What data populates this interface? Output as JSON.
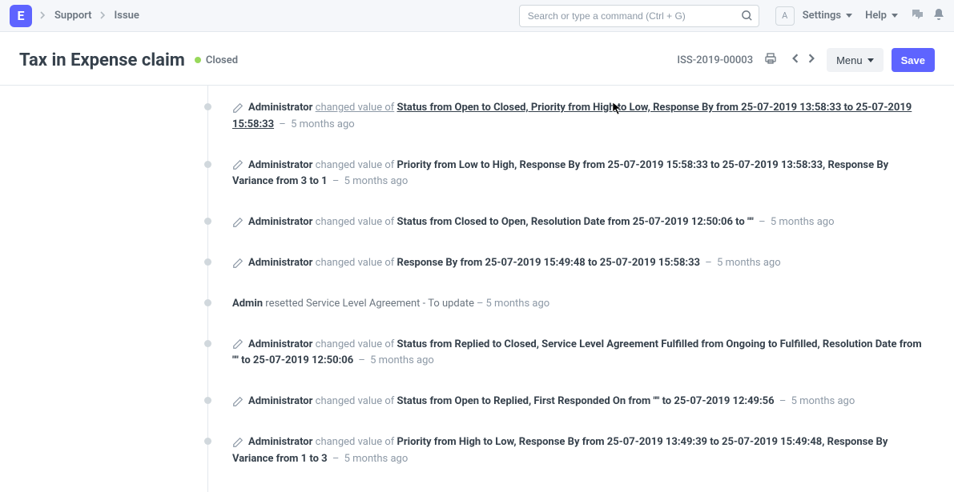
{
  "brand": "E",
  "breadcrumb": {
    "support": "Support",
    "issue": "Issue"
  },
  "search": {
    "placeholder": "Search or type a command (Ctrl + G)"
  },
  "user_initial": "A",
  "nav": {
    "settings": "Settings",
    "help": "Help"
  },
  "page": {
    "title": "Tax in Expense claim",
    "status": "Closed",
    "doc_id": "ISS-2019-00003",
    "menu": "Menu",
    "save": "Save"
  },
  "timeline": [
    {
      "type": "edit_link",
      "author": "Administrator",
      "middle": "changed value of",
      "desc": "Status from Open to Closed, Priority from High to Low, Response By from 25-07-2019 13:58:33 to 25-07-2019 15:58:33",
      "ago": "5 months ago"
    },
    {
      "type": "edit",
      "author": "Administrator",
      "middle": "changed value of",
      "desc": "Priority from Low to High, Response By from 25-07-2019 15:58:33 to 25-07-2019 13:58:33, Response By Variance from 3 to 1",
      "ago": "5 months ago"
    },
    {
      "type": "edit",
      "author": "Administrator",
      "middle": "changed value of",
      "desc": "Status from Closed to Open, Resolution Date from 25-07-2019 12:50:06 to \"\"",
      "ago": "5 months ago"
    },
    {
      "type": "edit",
      "author": "Administrator",
      "middle": "changed value of",
      "desc": "Response By from 25-07-2019 15:49:48 to 25-07-2019 15:58:33",
      "ago": "5 months ago"
    },
    {
      "type": "plain",
      "author": "Admin",
      "middle": "resetted Service Level Agreement - To update",
      "ago": "5 months ago"
    },
    {
      "type": "edit",
      "author": "Administrator",
      "middle": "changed value of",
      "desc": "Status from Replied to Closed, Service Level Agreement Fulfilled from Ongoing to Fulfilled, Resolution Date from \"\" to 25-07-2019 12:50:06",
      "ago": "5 months ago"
    },
    {
      "type": "edit",
      "author": "Administrator",
      "middle": "changed value of",
      "desc": "Status from Open to Replied, First Responded On from \"\" to 25-07-2019 12:49:56",
      "ago": "5 months ago"
    },
    {
      "type": "edit",
      "author": "Administrator",
      "middle": "changed value of",
      "desc": "Priority from High to Low, Response By from 25-07-2019 13:49:39 to 25-07-2019 15:49:48, Response By Variance from 1 to 3",
      "ago": "5 months ago"
    }
  ]
}
